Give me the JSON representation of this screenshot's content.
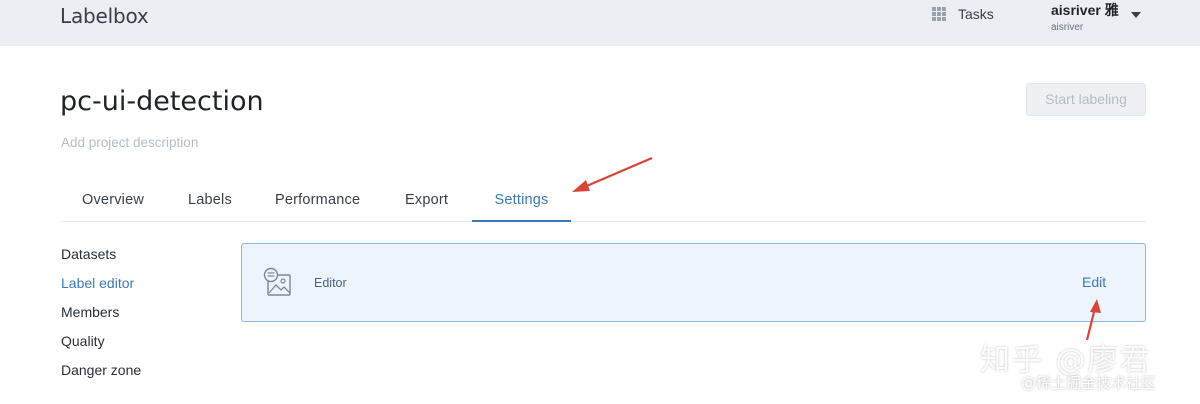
{
  "topbar": {
    "logo": "Labelbox",
    "tasks_label": "Tasks",
    "user_name": "aisriver 雅",
    "user_sub": "aisriver"
  },
  "project": {
    "title": "pc-ui-detection",
    "description_placeholder": "Add project description",
    "start_label": "Start labeling"
  },
  "tabs": [
    {
      "label": "Overview"
    },
    {
      "label": "Labels"
    },
    {
      "label": "Performance"
    },
    {
      "label": "Export"
    },
    {
      "label": "Settings"
    }
  ],
  "active_tab": "Settings",
  "sidenav": [
    {
      "label": "Datasets"
    },
    {
      "label": "Label editor"
    },
    {
      "label": "Members"
    },
    {
      "label": "Quality"
    },
    {
      "label": "Danger zone"
    }
  ],
  "active_nav": "Label editor",
  "editor_card": {
    "label": "Editor",
    "edit_label": "Edit"
  },
  "watermark": {
    "line1": "知乎 @廖君",
    "line2": "@稀土掘金技术社区"
  },
  "colors": {
    "accent": "#3d79b8",
    "topbar_bg": "#ebeef2",
    "card_bg": "#eef4fb",
    "card_border": "#8fb6e0",
    "annotation_arrow": "#d9443a"
  }
}
